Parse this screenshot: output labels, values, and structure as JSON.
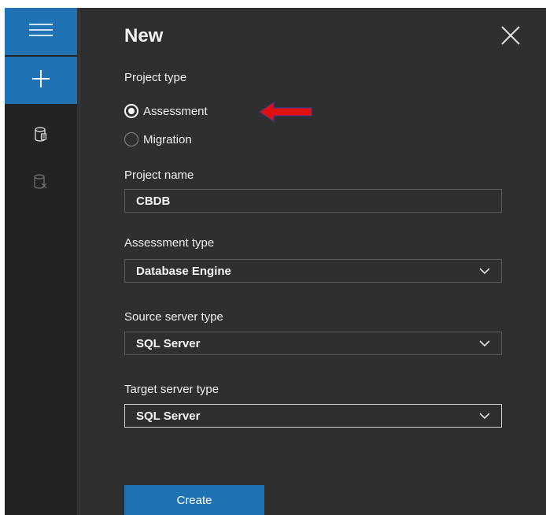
{
  "panel": {
    "title": "New"
  },
  "project_type": {
    "label": "Project type",
    "options": [
      {
        "label": "Assessment",
        "selected": true
      },
      {
        "label": "Migration",
        "selected": false
      }
    ]
  },
  "project_name": {
    "label": "Project name",
    "value": "CBDB"
  },
  "assessment_type": {
    "label": "Assessment type",
    "value": "Database Engine"
  },
  "source_server_type": {
    "label": "Source server type",
    "value": "SQL Server"
  },
  "target_server_type": {
    "label": "Target server type",
    "value": "SQL Server"
  },
  "actions": {
    "create_label": "Create"
  },
  "icons": {
    "menu": "hamburger-menu-icon",
    "new": "plus-icon",
    "assessment": "database-icon",
    "migration": "database-x-icon",
    "close": "close-icon",
    "dropdown": "chevron-down-icon",
    "annotation": "red-arrow-icon"
  },
  "colors": {
    "accent": "#1f72b3",
    "background": "#2f2f2f",
    "rail": "#232323",
    "annotation_arrow": "#e01010"
  }
}
